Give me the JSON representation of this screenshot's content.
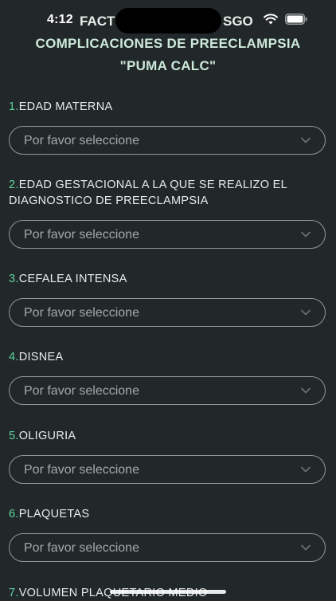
{
  "status": {
    "time": "4:12",
    "title_left": "FACT",
    "title_right": "SGO"
  },
  "title": {
    "line1": "COMPLICACIONES DE PREECLAMPSIA",
    "line2": "\"PUMA CALC\""
  },
  "placeholder": "Por favor seleccione",
  "questions": [
    {
      "num": "1.",
      "text": "EDAD MATERNA"
    },
    {
      "num": "2.",
      "text": "EDAD GESTACIONAL A LA QUE SE REALIZO EL DIAGNOSTICO DE PREECLAMPSIA"
    },
    {
      "num": "3.",
      "text": "CEFALEA INTENSA"
    },
    {
      "num": "4.",
      "text": "DISNEA"
    },
    {
      "num": "5.",
      "text": "OLIGURIA"
    },
    {
      "num": "6.",
      "text": "PLAQUETAS"
    },
    {
      "num": "7.",
      "text": "VOLUMEN PLAQUETARIO MEDIO"
    }
  ],
  "colors": {
    "background": "#222829",
    "accent_number": "#5fd39f",
    "title": "#cde9da",
    "field_border": "#8f9a97"
  },
  "icons": [
    "wifi-icon",
    "battery-icon",
    "chevron-down-icon"
  ]
}
